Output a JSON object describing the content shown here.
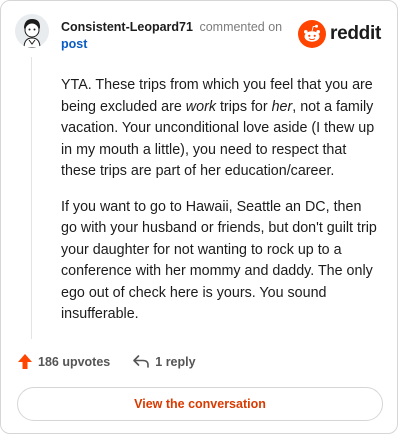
{
  "header": {
    "username": "Consistent-Leopard71",
    "action": "commented on",
    "post_link": "post",
    "brand": "reddit",
    "brand_color": "#ff4500"
  },
  "comment": {
    "p1": {
      "t1": "YTA. These trips from which you feel that you are being excluded are ",
      "em1": "work",
      "t2": " trips for ",
      "em2": "her",
      "t3": ", not a family vacation. Your unconditional love aside (I thew up in my mouth a little), you need to respect that these trips are part of her education/career."
    },
    "p2": "If you want to go to Hawaii, Seattle an DC, then go with your husband or friends, but don't guilt trip your daughter for not wanting to rock up to a conference with her mommy and daddy. The only ego out of check here is yours. You sound insufferable."
  },
  "footer": {
    "upvotes": "186 upvotes",
    "replies": "1 reply",
    "view_button": "View the conversation",
    "upvote_color": "#ff4500"
  }
}
